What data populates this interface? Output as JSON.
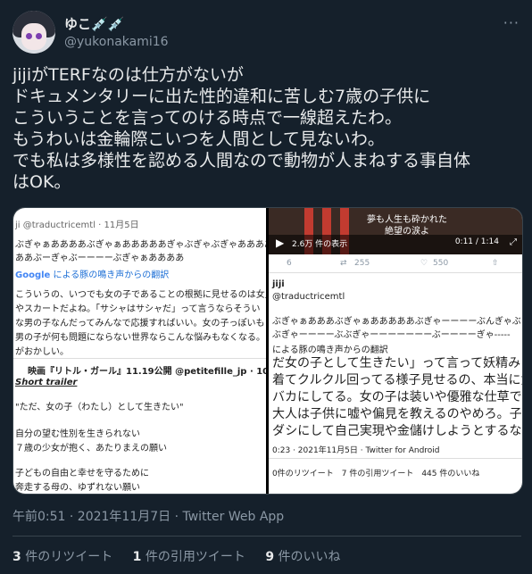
{
  "tweet": {
    "display_name": "ゆこ💉💉",
    "handle": "@yukonakami16",
    "more": "···",
    "text_lines": [
      "jijiがTERFなのは仕方がないが",
      "ドキュメンタリーに出た性的違和に苦しむ7歳の子供に",
      "こういうことを言ってのける時点で一線超えたわ。",
      "もうわいは金輪際こいつを人間として見ないわ。",
      "でも私は多様性を認める人間なので動物が人まねする事自体",
      "はOK。"
    ],
    "timestamp": "午前0:51 · 2021年11月7日 · Twitter Web App",
    "stats": {
      "retweets_count": "3",
      "retweets_label": "件のリツイート",
      "quotes_count": "1",
      "quotes_label": "件の引用ツイート",
      "likes_count": "9",
      "likes_label": "件のいいね"
    }
  },
  "left_image": {
    "header": "ji @traductricemtl · 11月5日",
    "lines": [
      "ぶぎゃぁああああぶぎゃぁあああああぎゃぶぎゃぶぎゃああああ",
      "ああぶーぎゃぶーーーーぶぎゃぁああああ",
      "による豚の鳴き声からの翻訳",
      "こういうの、いつでも女の子であることの根拠に見せるのは女児",
      "やスカートだよね。「サシャはサシャだ」って言うならそうい",
      "な男の子なんだってみんなで応援すればいい。女の子っぽいも",
      "男の子が何も問題にならない世界ならこんな悩みもなくなる。",
      "がおかしい。"
    ],
    "google": "Google",
    "quote_header": "映画『リトル・ガール』11.19公開 @petitefille_jp · 10月19日",
    "short_trailer": "Short trailer",
    "quote_lines": [
      "\"ただ、女の子（わたし）として生きたい\"",
      "自分の望む性別を生きられない",
      "７歳の少女が抱く、あたりまえの願い",
      "子どもの自由と幸せを守るために",
      "奔走する母の、ゆずれない願い"
    ]
  },
  "right_image": {
    "video_caption_1": "夢も人生も砕かれた",
    "video_caption_2": "絶望の涙よ",
    "views": "2.6万 件の表示",
    "time": "0:11 / 1:14",
    "replies": "6",
    "retweets": "255",
    "likes": "550",
    "author": "jiji",
    "handle": "@traductricemtl",
    "lines": [
      "ぶぎゃぁあああぶぎゃぁあああああぶぎゃーーーーぶんぎゃぶぎゃぁ",
      "ぶぎゃーーーーぶぶぎゃーーーーーーーぶーーーーぎゃ-----",
      "による豚の鳴き声からの翻訳",
      "だ女の子として生きたい」って言って妖精み",
      "着てクルクル回ってる様子見せるの、本当に女",
      "バカにしてる。女の子は装いや優雅な仕草では",
      "大人は子供に嘘や偏見を教えるのやめろ。子供",
      "ダシにして自己実現や金儲けしようとするな。"
    ],
    "meta": "0:23 · 2021年11月5日 · Twitter for Android",
    "footer": "0件のリツイート　7 件の引用ツイート　445 件のいいね"
  },
  "colors": {
    "background": "#15202b",
    "text": "#e7e9ea",
    "secondary": "#8b98a5",
    "link": "#1d6fd6"
  }
}
